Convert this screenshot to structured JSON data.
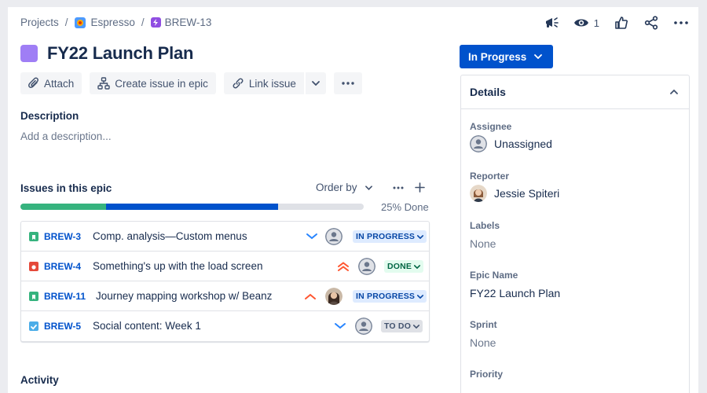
{
  "breadcrumb": {
    "projects": "Projects",
    "project": "Espresso",
    "issue_key": "BREW-13",
    "separator": "/"
  },
  "top_actions": {
    "watch_count": "1",
    "icons": [
      "megaphone-icon",
      "eye-icon",
      "thumbs-up-icon",
      "share-icon",
      "more-icon"
    ]
  },
  "epic": {
    "title": "FY22 Launch Plan",
    "color": "#9f7ef5"
  },
  "toolbar": {
    "attach": "Attach",
    "create_issue": "Create issue in epic",
    "link_issue": "Link issue"
  },
  "description": {
    "label": "Description",
    "placeholder": "Add a description..."
  },
  "issues": {
    "label": "Issues in this epic",
    "order_by": "Order by",
    "progress_label": "25% Done",
    "progress_done_fraction": 0.25,
    "progress_in_progress_fraction": 0.5,
    "rows": [
      {
        "key": "BREW-3",
        "summary": "Comp. analysis—Custom menus",
        "type": "story",
        "priority": "low",
        "assignee": "unassigned",
        "status": "IN PROGRESS"
      },
      {
        "key": "BREW-4",
        "summary": "Something's up with the load screen",
        "type": "bug",
        "priority": "highest",
        "assignee": "unassigned",
        "status": "DONE"
      },
      {
        "key": "BREW-11",
        "summary": "Journey mapping workshop w/ Beanz",
        "type": "story",
        "priority": "high",
        "assignee": "photo",
        "status": "IN PROGRESS"
      },
      {
        "key": "BREW-5",
        "summary": "Social content: Week 1",
        "type": "task",
        "priority": "low",
        "assignee": "unassigned",
        "status": "TO DO"
      }
    ]
  },
  "activity": {
    "label": "Activity"
  },
  "status_button": {
    "label": "In Progress"
  },
  "details": {
    "title": "Details",
    "assignee_label": "Assignee",
    "assignee_value": "Unassigned",
    "reporter_label": "Reporter",
    "reporter_value": "Jessie Spiteri",
    "labels_label": "Labels",
    "labels_value": "None",
    "epic_name_label": "Epic Name",
    "epic_name_value": "FY22 Launch Plan",
    "sprint_label": "Sprint",
    "sprint_value": "None",
    "priority_label": "Priority"
  },
  "colors": {
    "primary": "#0052cc",
    "done_green": "#36b37e",
    "text": "#172b4d",
    "subtle": "#5e6c84"
  }
}
